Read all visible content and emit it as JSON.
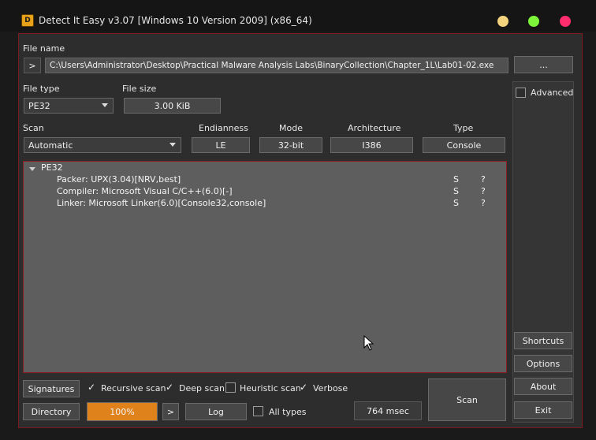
{
  "app": {
    "title": "Detect It Easy v3.07 [Windows 10 Version 2009] (x86_64)",
    "icon": "die-logo-icon",
    "window_controls": {
      "minimize_color": "#f3d37d",
      "maximize_color": "#7cf53a",
      "close_color": "#ff2d6e"
    }
  },
  "file": {
    "label": "File name",
    "expand_label": ">",
    "path": "C:\\Users\\Administrator\\Desktop\\Practical Malware Analysis Labs\\BinaryCollection\\Chapter_1L\\Lab01-02.exe",
    "browse_label": "..."
  },
  "file_type": {
    "label": "File type",
    "value": "PE32"
  },
  "file_size": {
    "label": "File size",
    "value": "3.00 KiB"
  },
  "scan_row": {
    "scan_label": "Scan",
    "scan_value": "Automatic",
    "endianness_label": "Endianness",
    "endianness_value": "LE",
    "mode_label": "Mode",
    "mode_value": "32-bit",
    "architecture_label": "Architecture",
    "architecture_value": "I386",
    "type_label": "Type",
    "type_value": "Console"
  },
  "results": {
    "root": "PE32",
    "items": [
      {
        "text": "Packer: UPX(3.04)[NRV,best]",
        "s": "S",
        "q": "?"
      },
      {
        "text": "Compiler: Microsoft Visual C/C++(6.0)[-]",
        "s": "S",
        "q": "?"
      },
      {
        "text": "Linker: Microsoft Linker(6.0)[Console32,console]",
        "s": "S",
        "q": "?"
      }
    ]
  },
  "side": {
    "advanced_label": "Advanced",
    "shortcuts_label": "Shortcuts",
    "options_label": "Options",
    "about_label": "About",
    "exit_label": "Exit"
  },
  "bottom": {
    "signatures_label": "Signatures",
    "recursive_label": "Recursive scan",
    "deep_label": "Deep scan",
    "heuristic_label": "Heuristic scan",
    "verbose_label": "Verbose",
    "directory_label": "Directory",
    "progress_text": "100%",
    "progress_value": 1.0,
    "next_label": ">",
    "log_label": "Log",
    "all_types_label": "All types",
    "time_label": "764 msec",
    "scan_button_label": "Scan",
    "recursive_checked": true,
    "deep_checked": true,
    "heuristic_checked": false,
    "verbose_checked": true,
    "all_types_checked": false
  },
  "colors": {
    "accent": "#e0821c",
    "border": "#8c1c22"
  }
}
